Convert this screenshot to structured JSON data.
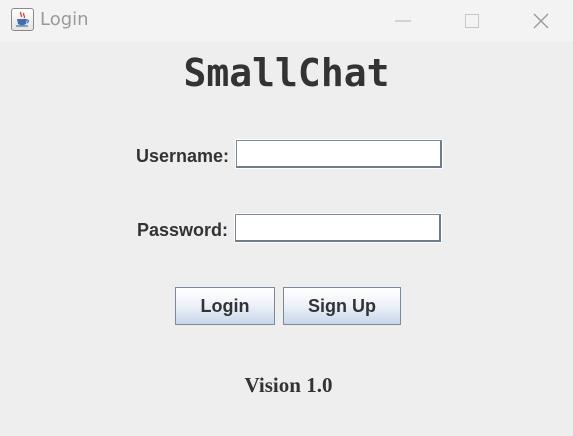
{
  "window": {
    "title": "Login",
    "icon": "java-cup-icon",
    "controls": {
      "minimize": "minimize-icon",
      "maximize": "maximize-icon",
      "close": "close-icon"
    }
  },
  "app": {
    "name": "SmallChat",
    "version_text": "Vision 1.0"
  },
  "form": {
    "username_label": "Username:",
    "username_value": "",
    "password_label": "Password:",
    "password_value": ""
  },
  "buttons": {
    "login_label": "Login",
    "signup_label": "Sign Up"
  },
  "colors": {
    "background": "#eeeeee",
    "text": "#333333",
    "button_gradient_bottom": "#c7d7ea",
    "border": "#7a8a99"
  }
}
